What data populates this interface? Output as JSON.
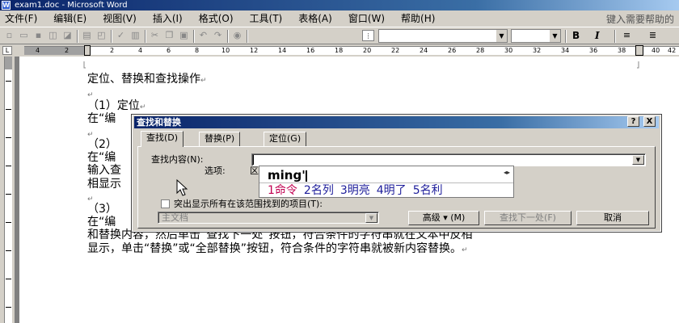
{
  "window": {
    "title": "exam1.doc - Microsoft Word",
    "help_box": "键入需要帮助的"
  },
  "menu": [
    "文件(F)",
    "编辑(E)",
    "视图(V)",
    "插入(I)",
    "格式(O)",
    "工具(T)",
    "表格(A)",
    "窗口(W)",
    "帮助(H)"
  ],
  "toolbar": {
    "bold": "B",
    "italic": "I"
  },
  "ruler": {
    "numbers": [
      "4",
      "2",
      "2",
      "4",
      "6",
      "8",
      "10",
      "12",
      "14",
      "16",
      "18",
      "20",
      "22",
      "24",
      "26",
      "28",
      "30",
      "32",
      "34",
      "36",
      "38",
      "40",
      "42",
      "44"
    ]
  },
  "document": {
    "lines": [
      "定位、替换和查找操作",
      "",
      "（1）定位",
      "在“编",
      "",
      "（2）",
      "在“编",
      "输入查",
      "相显示",
      "",
      "（3）",
      "在“编",
      "和替换内容，然后单击“查找下一处”按钮，符合条件的字符串就在文本中反相",
      "显示，单击“替换”或“全部替换”按钮，符合条件的字符串就被新内容替换。"
    ]
  },
  "dialog": {
    "title": "查找和替换",
    "help_btn": "?",
    "close_btn": "X",
    "tabs": [
      "查找(D)",
      "替换(P)",
      "定位(G)"
    ],
    "find_label": "查找内容(N):",
    "options_label": "选项:",
    "options_value": "区",
    "highlight_label": "突出显示所有在该范围找到的项目(T):",
    "scope_value": "主文档",
    "advanced_btn": "高级 ▾ (M)",
    "find_next_btn": "查找下一处(F)",
    "cancel_btn": "取消"
  },
  "ime": {
    "composition": "ming'",
    "candidates": [
      "1命令",
      "2名列",
      "3明亮",
      "4明了",
      "5名利"
    ],
    "nav": "◂▸"
  }
}
